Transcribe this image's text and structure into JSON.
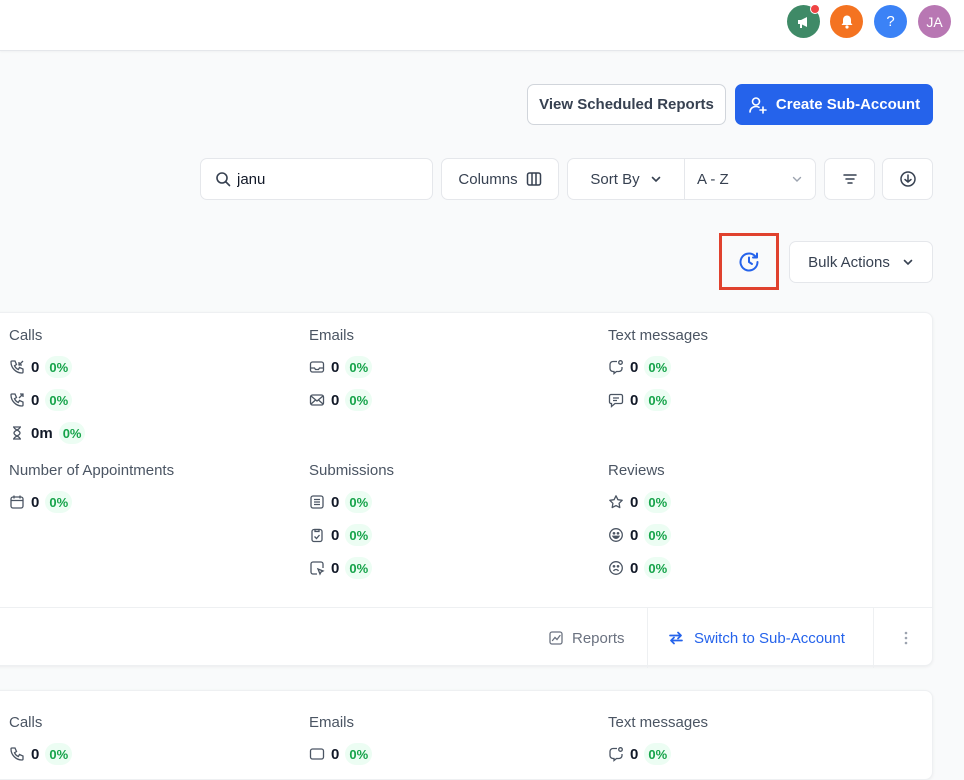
{
  "topbar": {
    "announce_icon": "megaphone-icon",
    "bell_icon": "bell-icon",
    "help_label": "?",
    "avatar_initials": "JA"
  },
  "actions": {
    "view_scheduled_reports": "View Scheduled Reports",
    "create_sub_account": "Create Sub-Account"
  },
  "toolbar": {
    "search_value": "janu",
    "columns_label": "Columns",
    "sort_by_label": "Sort By",
    "sort_value": "A - Z",
    "bulk_actions_label": "Bulk Actions"
  },
  "card1": {
    "calls": {
      "title": "Calls",
      "items": [
        {
          "icon": "incoming-call-icon",
          "value": "0",
          "pct": "0%"
        },
        {
          "icon": "outgoing-call-icon",
          "value": "0",
          "pct": "0%"
        },
        {
          "icon": "hourglass-icon",
          "value": "0m",
          "pct": "0%"
        }
      ]
    },
    "emails": {
      "title": "Emails",
      "items": [
        {
          "icon": "inbox-icon",
          "value": "0",
          "pct": "0%"
        },
        {
          "icon": "mail-icon",
          "value": "0",
          "pct": "0%"
        }
      ]
    },
    "texts": {
      "title": "Text messages",
      "items": [
        {
          "icon": "chat-bubble-dot-icon",
          "value": "0",
          "pct": "0%"
        },
        {
          "icon": "message-square-icon",
          "value": "0",
          "pct": "0%"
        }
      ]
    },
    "appointments": {
      "title": "Number of Appointments",
      "items": [
        {
          "icon": "calendar-icon",
          "value": "0",
          "pct": "0%"
        }
      ]
    },
    "submissions": {
      "title": "Submissions",
      "items": [
        {
          "icon": "form-icon",
          "value": "0",
          "pct": "0%"
        },
        {
          "icon": "clipboard-check-icon",
          "value": "0",
          "pct": "0%"
        },
        {
          "icon": "survey-icon",
          "value": "0",
          "pct": "0%"
        }
      ]
    },
    "reviews": {
      "title": "Reviews",
      "items": [
        {
          "icon": "star-icon",
          "value": "0",
          "pct": "0%"
        },
        {
          "icon": "smile-icon",
          "value": "0",
          "pct": "0%"
        },
        {
          "icon": "frown-icon",
          "value": "0",
          "pct": "0%"
        }
      ]
    },
    "footer": {
      "reports_label": "Reports",
      "switch_label": "Switch to Sub-Account"
    }
  },
  "card2": {
    "calls_title": "Calls",
    "emails_title": "Emails",
    "texts_title": "Text messages",
    "value": "0",
    "pct": "0%"
  },
  "colors": {
    "primary": "#2563eb",
    "highlight_border": "#e0412e",
    "pct_text": "#16a34a",
    "pct_bg": "#ecfdf3"
  }
}
